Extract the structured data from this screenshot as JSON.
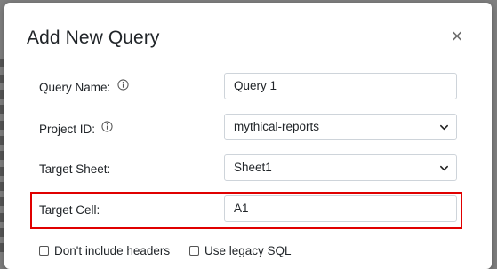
{
  "dialog": {
    "title": "Add New Query",
    "close_label": "×"
  },
  "form": {
    "query_name": {
      "label": "Query Name:",
      "value": "Query 1",
      "has_info_icon": true
    },
    "project_id": {
      "label": "Project ID:",
      "value": "mythical-reports",
      "has_info_icon": true
    },
    "target_sheet": {
      "label": "Target Sheet:",
      "value": "Sheet1"
    },
    "target_cell": {
      "label": "Target Cell:",
      "value": "A1",
      "highlighted": true
    }
  },
  "options": {
    "no_headers_label": "Don't include headers",
    "no_headers_checked": false,
    "legacy_sql_label": "Use legacy SQL",
    "legacy_sql_checked": false
  },
  "colors": {
    "highlight": "#e00000",
    "backdrop": "#808080"
  }
}
